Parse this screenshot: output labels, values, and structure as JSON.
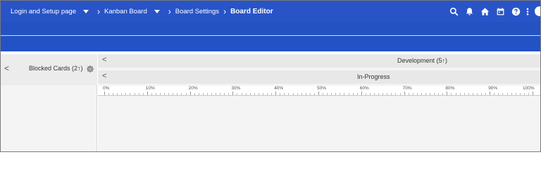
{
  "breadcrumbs": [
    {
      "label": "Login and Setup page",
      "has_dropdown": true
    },
    {
      "label": "Kanban Board",
      "has_dropdown": true
    },
    {
      "label": "Board Settings",
      "has_dropdown": false
    },
    {
      "label": "Board Editor",
      "has_dropdown": false,
      "current": true
    }
  ],
  "header_icons": [
    "search-icon",
    "bell-icon",
    "home-icon",
    "calendar-icon",
    "help-icon",
    "more-vertical-icon",
    "user-avatar"
  ],
  "left_column": {
    "title": "Blocked Cards (2↑)",
    "collapse_glyph": "<",
    "settings_icon": "gear-icon"
  },
  "lanes": [
    {
      "title": "Development (5↑)",
      "collapse_glyph": "<"
    },
    {
      "title": "In-Progress",
      "collapse_glyph": "<"
    }
  ],
  "ruler": {
    "labels": [
      "0%",
      "10%",
      "20%",
      "30%",
      "40%",
      "50%",
      "60%",
      "70%",
      "80%",
      "90%",
      "100%"
    ]
  },
  "colors": {
    "header_bg": "#2854c8",
    "lane_bg": "#e8e8e8",
    "panel_bg": "#f4f4f4"
  }
}
